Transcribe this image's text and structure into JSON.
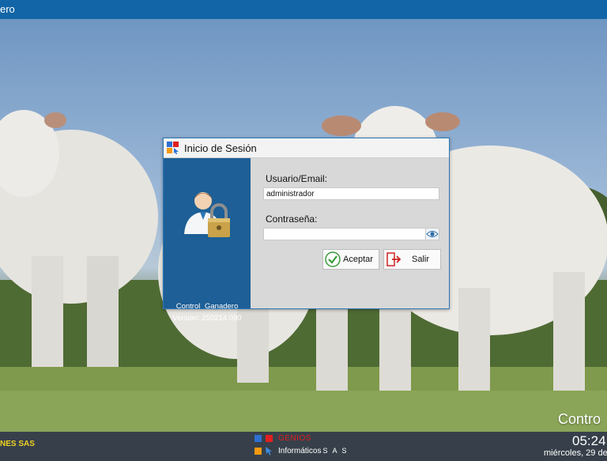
{
  "window": {
    "title": "ero"
  },
  "dialog": {
    "title": "Inicio de Sesión",
    "app_name": "Control  Ganadero",
    "version_label": "Versión: 250214.090",
    "username_label": "Usuario/Email:",
    "username_value": "administrador",
    "password_label": "Contraseña:",
    "password_value": "",
    "accept_label": "Aceptar",
    "exit_label": "Salir"
  },
  "footer": {
    "company": "NES SAS",
    "brand_line1": "GENIOS",
    "brand_line2": "Informáticos",
    "brand_line2_suffix": "S A S",
    "time": "05:24",
    "date": "miércoles, 29 de",
    "app_banner": "Contro"
  },
  "colors": {
    "title_bar": "#1265a6",
    "dialog_panel": "#1d5f96",
    "bottom_bar": "#37404a",
    "company_text": "#f2d321",
    "genios_text": "#e02020"
  },
  "icons": [
    "app-logo-icon",
    "user-lock-icon",
    "eye-icon",
    "check-icon",
    "exit-door-icon"
  ]
}
